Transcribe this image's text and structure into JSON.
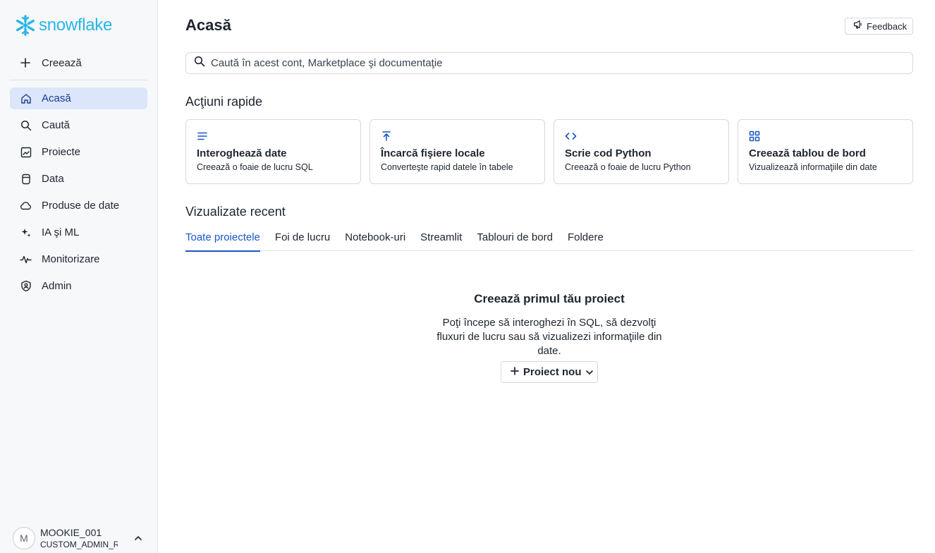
{
  "app": {
    "logo_text": "snowflake",
    "brand_color": "#29b5e8",
    "accent_color": "#1a56c4"
  },
  "sidebar": {
    "create_label": "Creează",
    "items": [
      {
        "label": "Acasă",
        "icon": "home-icon",
        "active": true
      },
      {
        "label": "Caută",
        "icon": "search-icon"
      },
      {
        "label": "Proiecte",
        "icon": "projects-icon"
      },
      {
        "label": "Data",
        "icon": "database-icon"
      },
      {
        "label": "Produse de date",
        "icon": "cloud-icon"
      },
      {
        "label": "IA şi ML",
        "icon": "sparkle-icon"
      },
      {
        "label": "Monitorizare",
        "icon": "activity-icon"
      },
      {
        "label": "Admin",
        "icon": "shield-icon"
      }
    ],
    "user": {
      "avatar_letter": "M",
      "name": "MOOKIE_001",
      "role": "CUSTOM_ADMIN_ROLE"
    }
  },
  "header": {
    "title": "Acasă",
    "feedback_label": "Feedback"
  },
  "search": {
    "placeholder": "Caută în acest cont, Marketplace şi documentaţie"
  },
  "quick_actions": {
    "title": "Acţiuni rapide",
    "cards": [
      {
        "title": "Interoghează date",
        "subtitle": "Creează o foaie de lucru SQL",
        "icon": "text-lines-icon"
      },
      {
        "title": "Încarcă fişiere locale",
        "subtitle": "Converteşte rapid datele în tabele",
        "icon": "upload-icon"
      },
      {
        "title": "Scrie cod Python",
        "subtitle": "Creează o foaie de lucru Python",
        "icon": "code-icon"
      },
      {
        "title": "Creează tablou de bord",
        "subtitle": "Vizualizează informaţiile din date",
        "icon": "grid-icon"
      }
    ]
  },
  "recent": {
    "title": "Vizualizate recent",
    "tabs": [
      {
        "label": "Toate proiectele",
        "active": true
      },
      {
        "label": "Foi de lucru"
      },
      {
        "label": "Notebook-uri"
      },
      {
        "label": "Streamlit"
      },
      {
        "label": "Tablouri de bord"
      },
      {
        "label": "Foldere"
      }
    ],
    "empty_title": "Creează primul tău proiect",
    "empty_desc": "Poţi începe să interoghezi în SQL, să dezvolţi fluxuri de lucru sau să vizualizezi informaţiile din date.",
    "new_project_label": "Proiect nou"
  }
}
